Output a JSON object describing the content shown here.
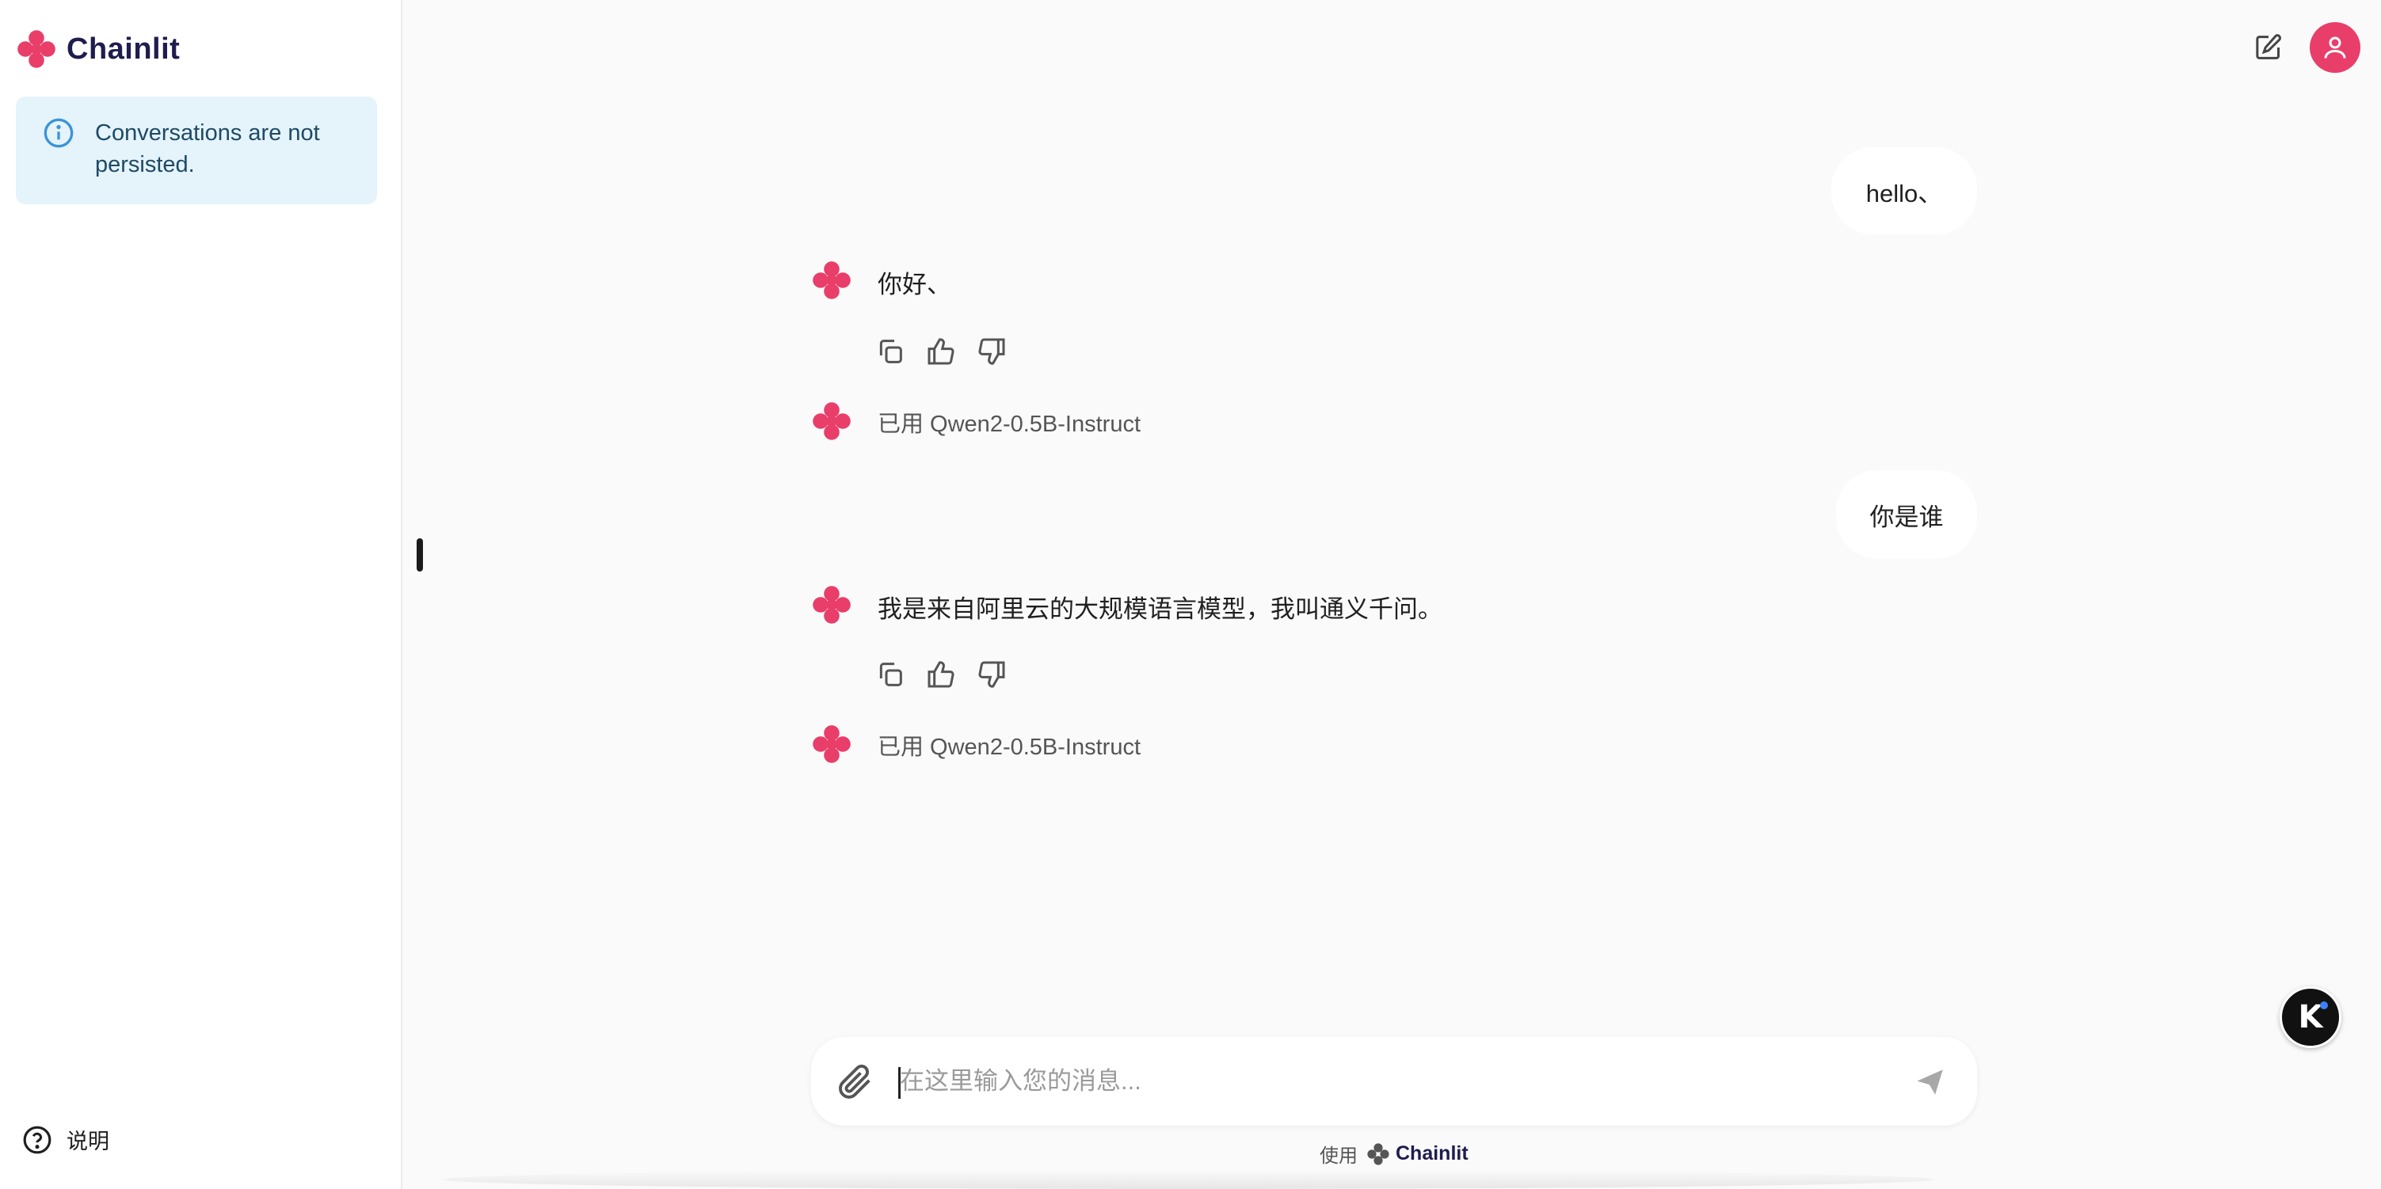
{
  "app": {
    "name": "Chainlit"
  },
  "sidebar": {
    "notice": "Conversations are not persisted.",
    "help_label": "说明"
  },
  "chat": {
    "messages": [
      {
        "role": "user",
        "text": "hello、"
      },
      {
        "role": "assistant",
        "text": "你好、",
        "step": "已用 Qwen2-0.5B-Instruct"
      },
      {
        "role": "user",
        "text": "你是谁"
      },
      {
        "role": "assistant",
        "text": "我是来自阿里云的大规模语言模型，我叫通义千问。",
        "step": "已用 Qwen2-0.5B-Instruct"
      }
    ]
  },
  "composer": {
    "placeholder": "在这里输入您的消息...",
    "value": ""
  },
  "footer": {
    "prefix": "使用",
    "brand": "Chainlit"
  },
  "widget": {
    "label": "K"
  },
  "colors": {
    "accent": "#e93e6a",
    "brand_text": "#1f1d4d",
    "notice_bg": "#e5f3fb",
    "notice_icon": "#3b94d6"
  },
  "icons": [
    "chainlit-logo-icon",
    "info-icon",
    "help-circle-icon",
    "edit-icon",
    "user-icon",
    "copy-icon",
    "thumbs-up-icon",
    "thumbs-down-icon",
    "paperclip-icon",
    "send-icon"
  ]
}
